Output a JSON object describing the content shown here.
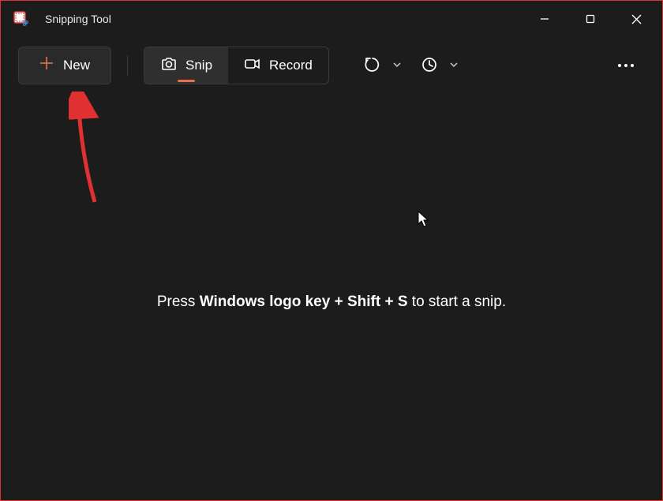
{
  "app": {
    "title": "Snipping Tool"
  },
  "toolbar": {
    "new_label": "New",
    "snip_label": "Snip",
    "record_label": "Record"
  },
  "hint": {
    "prefix": "Press ",
    "shortcut_part1": "Windows logo key",
    "plus1": " + ",
    "shortcut_part2": "Shift",
    "plus2": " + ",
    "shortcut_part3": "S",
    "suffix": " to start a snip."
  },
  "colors": {
    "accent": "#e87050",
    "annotation": "#e03030"
  }
}
